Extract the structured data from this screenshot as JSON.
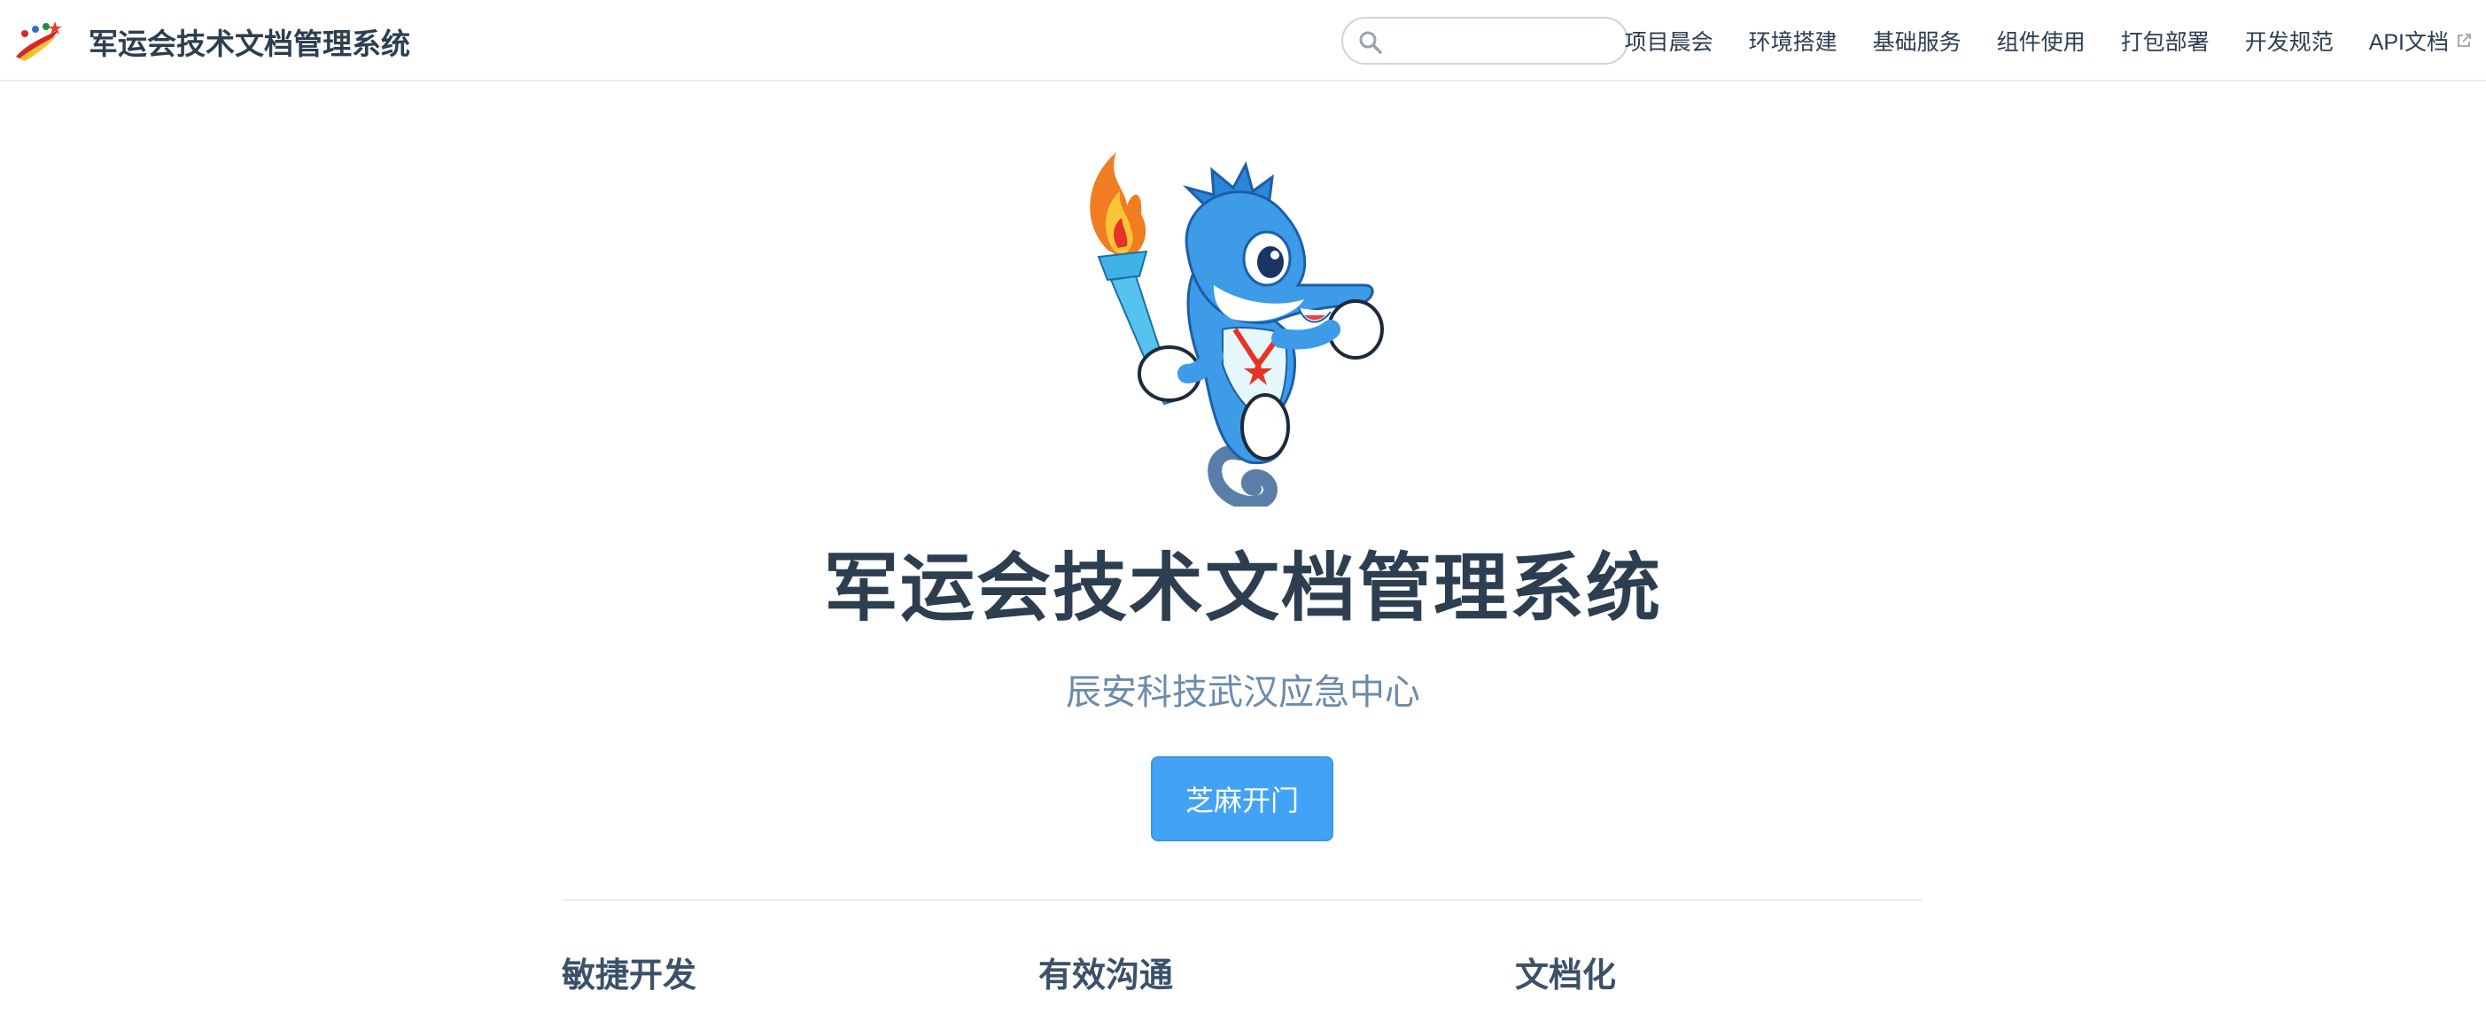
{
  "navbar": {
    "title": "军运会技术文档管理系统",
    "logo_icon": "site-logo-icon",
    "search": {
      "placeholder": "",
      "value": ""
    },
    "links": [
      {
        "label": "项目晨会"
      },
      {
        "label": "环境搭建"
      },
      {
        "label": "基础服务"
      },
      {
        "label": "组件使用"
      },
      {
        "label": "打包部署"
      },
      {
        "label": "开发规范"
      },
      {
        "label": "API文档",
        "external": true
      }
    ]
  },
  "hero": {
    "image": "mascot-seahorse-torch-image",
    "title": "军运会技术文档管理系统",
    "subtitle": "辰安科技武汉应急中心",
    "action_label": "芝麻开门"
  },
  "features": [
    {
      "title": "敏捷开发"
    },
    {
      "title": "有效沟通"
    },
    {
      "title": "文档化"
    }
  ],
  "colors": {
    "text": "#2c3e50",
    "subtitle": "#6a8bad",
    "accent": "#42a2f6",
    "border": "#eaecef"
  }
}
